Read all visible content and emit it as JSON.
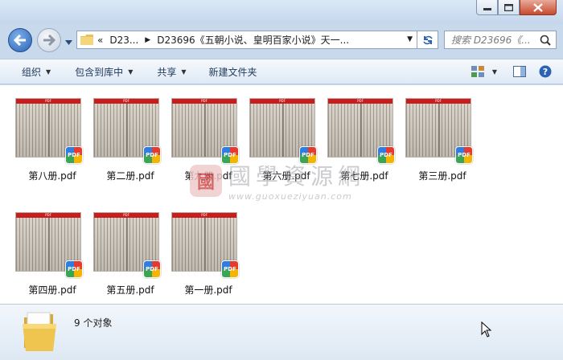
{
  "address": {
    "chevrons": "«",
    "crumb1": "D23...",
    "crumb2": "D23696《五朝小说、皇明百家小说》天一..."
  },
  "search": {
    "placeholder": "搜索 D23696《..."
  },
  "toolbar": {
    "organize": "组织",
    "include_library": "包含到库中",
    "share": "共享",
    "new_folder": "新建文件夹"
  },
  "files": [
    {
      "name": "第八册.pdf"
    },
    {
      "name": "第二册.pdf"
    },
    {
      "name": "第九册.pdf"
    },
    {
      "name": "第六册.pdf"
    },
    {
      "name": "第七册.pdf"
    },
    {
      "name": "第三册.pdf"
    },
    {
      "name": "第四册.pdf"
    },
    {
      "name": "第五册.pdf"
    },
    {
      "name": "第一册.pdf"
    }
  ],
  "thumb_label": "PDF",
  "badge_label": "PDF",
  "watermark": {
    "chinese": "國學資源網",
    "url": "www.guoxueziyuan.com",
    "seal": "國"
  },
  "status": {
    "count": "9 个对象"
  },
  "colors": {
    "accent": "#2a63b5",
    "toolbar_text": "#1e395b",
    "close_btn": "#c7482e",
    "thumb_bar": "#c91c1c"
  }
}
